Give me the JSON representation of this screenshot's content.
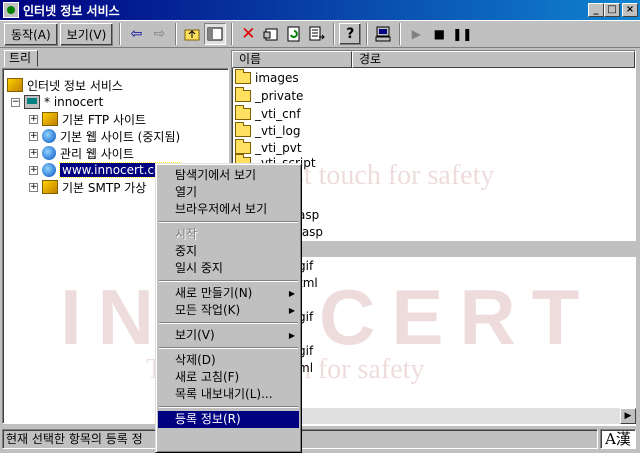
{
  "window": {
    "title": "인터넷 정보 서비스",
    "minimize_glyph": "_",
    "maximize_glyph": "□",
    "close_glyph": "×"
  },
  "toolbar": {
    "menus": [
      "동작(A)",
      "보기(V)"
    ],
    "icons": [
      "back-arrow-icon",
      "forward-arrow-icon",
      "up-folder-icon",
      "show-hide-tree-icon",
      "delete-icon",
      "properties-icon",
      "refresh-icon",
      "export-list-icon",
      "help-icon",
      "computer-icon",
      "play-icon",
      "stop-icon",
      "pause-icon"
    ]
  },
  "tree": {
    "tab_label": "트리",
    "nodes": [
      {
        "label": "인터넷 정보 서비스",
        "icon": "iis-icon"
      },
      {
        "label": "* innocert",
        "icon": "computer-icon"
      },
      {
        "label": "기본 FTP 사이트",
        "icon": "ftp-site-icon"
      },
      {
        "label": "기본 웹 사이트 (중지됨)",
        "icon": "web-site-icon"
      },
      {
        "label": "관리 웹 사이트",
        "icon": "web-site-icon"
      },
      {
        "label": "www.innocert.co.kr",
        "icon": "web-site-icon"
      },
      {
        "label": "기본 SMTP 가상",
        "icon": "smtp-icon"
      }
    ]
  },
  "list": {
    "columns": [
      "이름",
      "경로"
    ],
    "rows": [
      {
        "name": "images",
        "icon": "folder-icon"
      },
      {
        "name": "_private",
        "icon": "folder-icon"
      },
      {
        "name": "_vti_cnf",
        "icon": "folder-icon"
      },
      {
        "name": "_vti_log",
        "icon": "folder-icon"
      },
      {
        "name": "_vti_pvt",
        "icon": "folder-icon"
      },
      {
        "name": "_vti_script",
        "icon": "folder-icon"
      },
      {
        "name": "asp",
        "icon": "file-icon"
      },
      {
        "name": ".asp",
        "icon": "file-icon"
      },
      {
        "name": "gif",
        "icon": "file-icon"
      },
      {
        "name": "tml",
        "icon": "file-icon"
      },
      {
        "name": "gif",
        "icon": "file-icon"
      },
      {
        "name": "gif",
        "icon": "file-icon"
      },
      {
        "name": "ml",
        "icon": "file-icon"
      }
    ]
  },
  "context_menu": {
    "items": [
      {
        "label": "탐색기에서 보기"
      },
      {
        "label": "열기"
      },
      {
        "label": "브라우저에서 보기"
      },
      {
        "separator": true
      },
      {
        "label": "시작",
        "disabled": true
      },
      {
        "label": "중지"
      },
      {
        "label": "일시 중지"
      },
      {
        "separator": true
      },
      {
        "label": "새로 만들기(N)",
        "submenu": true
      },
      {
        "label": "모든 작업(K)",
        "submenu": true
      },
      {
        "separator": true
      },
      {
        "label": "보기(V)",
        "submenu": true
      },
      {
        "separator": true
      },
      {
        "label": "삭제(D)"
      },
      {
        "label": "새로 고침(F)"
      },
      {
        "label": "목록 내보내기(L)..."
      },
      {
        "separator": true
      },
      {
        "label": "등록 정보(R)",
        "highlighted": true
      }
    ]
  },
  "statusbar": {
    "text": "현재 선택한 항목의 등록 정",
    "ime_indicator": "A漢"
  },
  "watermark": {
    "line1": "INNOCERT",
    "line2": "The first touch for safety"
  },
  "colors": {
    "titlebar_active": "#000080",
    "selection": "#000080",
    "face": "#c0c0c0"
  }
}
